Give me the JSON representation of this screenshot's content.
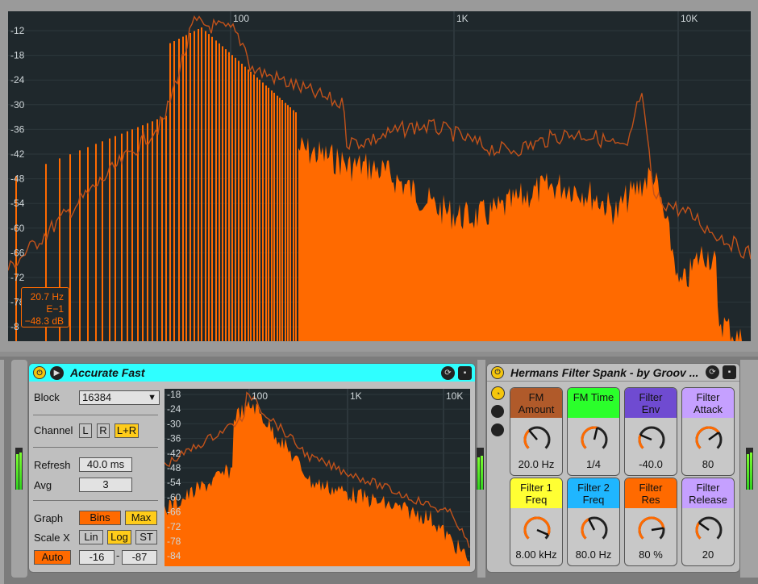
{
  "colors": {
    "accent_orange": "#ff6a00",
    "plot_bg": "#1f282c",
    "cyan_title": "#2fffff",
    "yellow": "#ffcc1a"
  },
  "big_spectrum": {
    "freq_labels": [
      "100",
      "1K",
      "10K"
    ],
    "db_labels": [
      "-12",
      "-18",
      "-24",
      "-30",
      "-36",
      "-42",
      "-48",
      "-54",
      "-60",
      "-66",
      "-72",
      "-78",
      "-8"
    ],
    "readout": {
      "freq": "20.7 Hz",
      "note": "E−1",
      "level": "−48.3 dB"
    }
  },
  "spectrum_device": {
    "title": "Accurate Fast",
    "block_label": "Block",
    "block_value": "16384",
    "channel_label": "Channel",
    "channel_options": [
      "L",
      "R",
      "L+R"
    ],
    "channel_selected": "L+R",
    "refresh_label": "Refresh",
    "refresh_value": "40.0 ms",
    "avg_label": "Avg",
    "avg_value": "3",
    "graph_label": "Graph",
    "graph_options": [
      "Bins",
      "Max"
    ],
    "scalex_label": "Scale X",
    "scalex_options": [
      "Lin",
      "Log",
      "ST"
    ],
    "scalex_selected": "Log",
    "auto_label": "Auto",
    "range_low": "-16",
    "range_sep": "-",
    "range_high": "-87",
    "freq_labels": [
      "100",
      "1K",
      "10K"
    ],
    "db_labels": [
      "-18",
      "-24",
      "-30",
      "-36",
      "-42",
      "-48",
      "-54",
      "-60",
      "-66",
      "-72",
      "-78",
      "-84"
    ]
  },
  "rack_device": {
    "title": "Hermans Filter Spank - by Groov ...",
    "macros": [
      {
        "name": "FM Amount",
        "line1": "FM",
        "line2": "Amount",
        "value": "20.0 Hz",
        "color": "#b05a2a",
        "knob": 0.35
      },
      {
        "name": "FM Time",
        "line1": "FM Time",
        "line2": "",
        "value": "1/4",
        "color": "#2bff2b",
        "knob": 0.55
      },
      {
        "name": "Filter Env",
        "line1": "Filter",
        "line2": "Env",
        "value": "-40.0",
        "color": "#6f4bd1",
        "knob": 0.25
      },
      {
        "name": "Filter Attack",
        "line1": "Filter",
        "line2": "Attack",
        "value": "80",
        "color": "#c5a0ff",
        "knob": 0.7
      },
      {
        "name": "Filter 1 Freq",
        "line1": "Filter  1",
        "line2": "Freq",
        "value": "8.00 kHz",
        "color": "#ffff33",
        "knob": 0.92
      },
      {
        "name": "Filter 2 Freq",
        "line1": "Filter  2",
        "line2": "Freq",
        "value": "80.0 Hz",
        "color": "#1fb6ff",
        "knob": 0.4
      },
      {
        "name": "Filter Res",
        "line1": "Filter",
        "line2": "Res",
        "value": "80 %",
        "color": "#ff6a00",
        "knob": 0.8
      },
      {
        "name": "Filter Release",
        "line1": "Filter",
        "line2": "Release",
        "value": "20",
        "color": "#c5a0ff",
        "knob": 0.3
      }
    ]
  }
}
